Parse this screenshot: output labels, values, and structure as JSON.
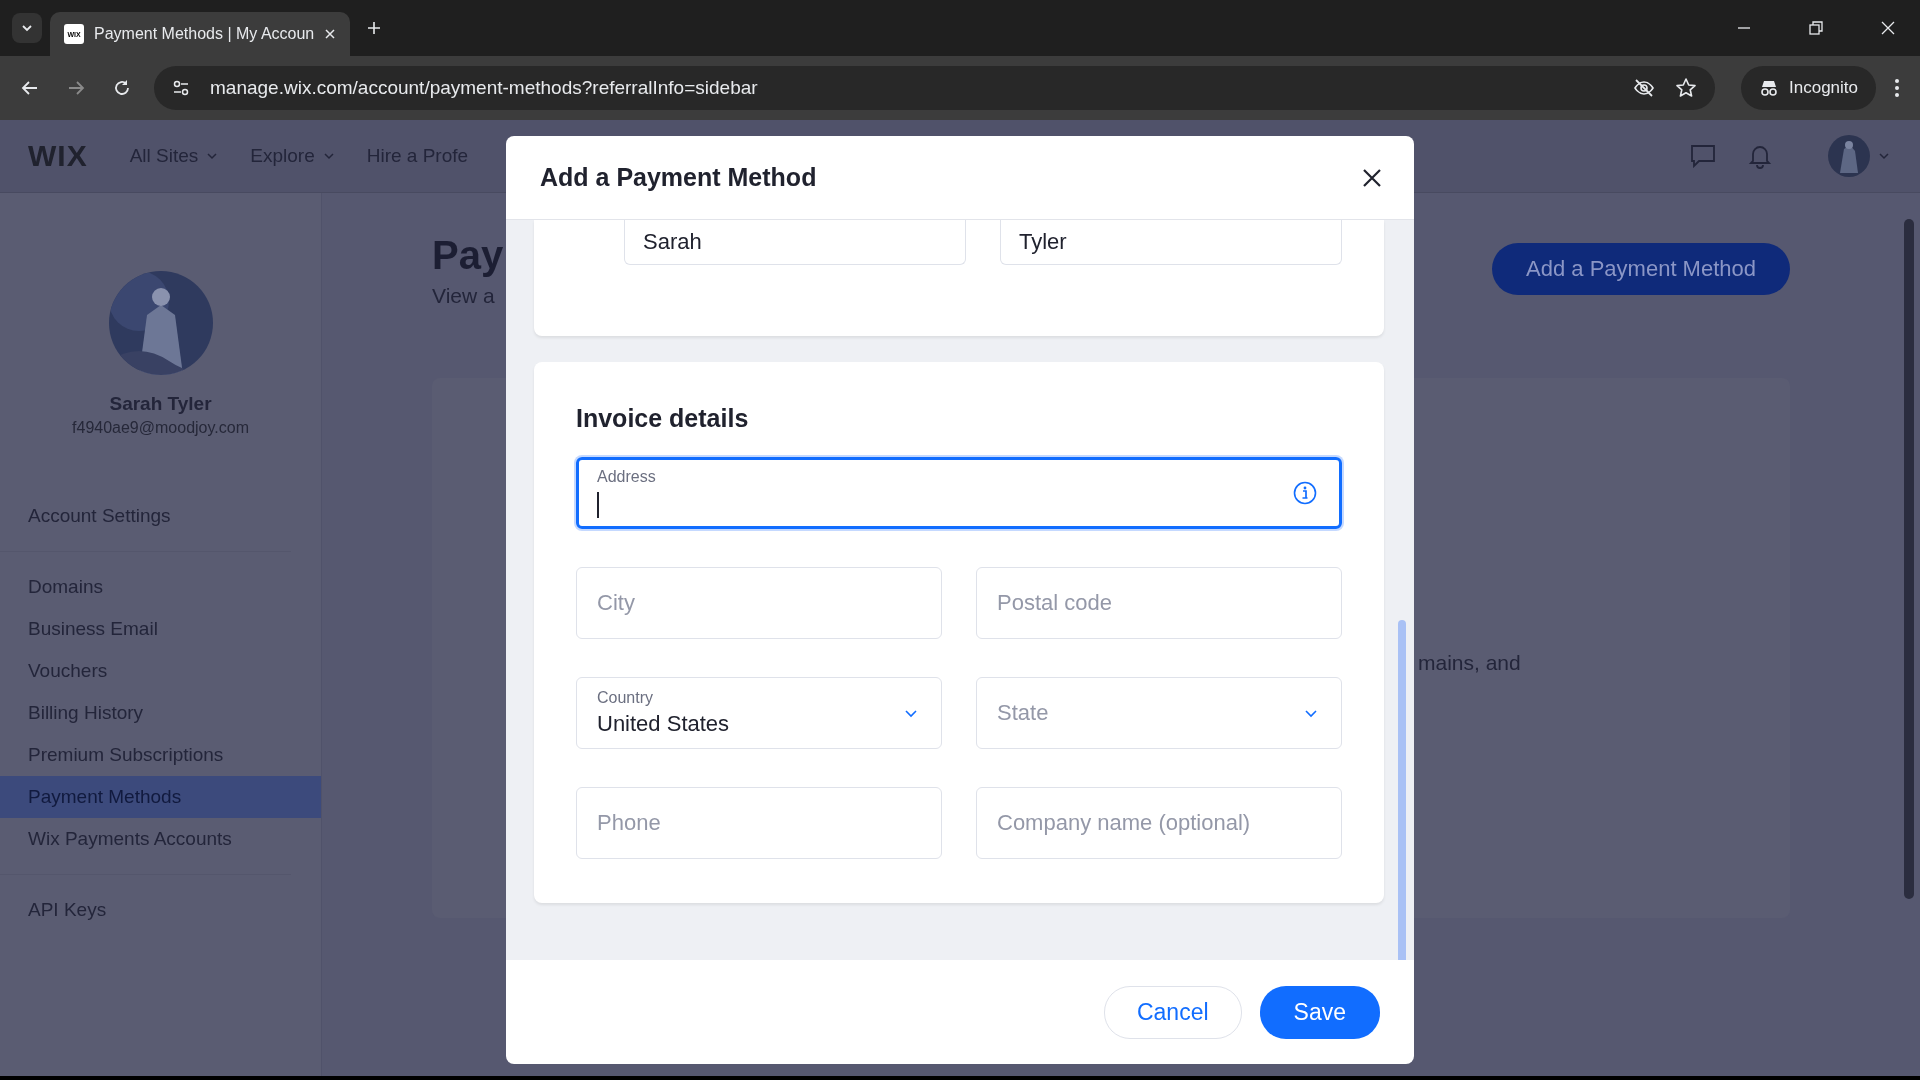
{
  "browser": {
    "tabs": [
      {
        "title": "Payment Methods | My Accoun",
        "favicon": "WIX",
        "selected": true
      }
    ],
    "url": "manage.wix.com/account/payment-methods?referralInfo=sidebar",
    "profile_label": "Incognito"
  },
  "header": {
    "logo": "WIX",
    "nav": [
      {
        "label": "All Sites",
        "dropdown": true
      },
      {
        "label": "Explore",
        "dropdown": true
      },
      {
        "label": "Hire a Profe",
        "dropdown": false
      }
    ]
  },
  "sidebar": {
    "user_name": "Sarah Tyler",
    "email": "f4940ae9@moodjoy.com",
    "groups": [
      [
        {
          "label": "Account Settings",
          "selected": false
        }
      ],
      [
        {
          "label": "Domains",
          "selected": false
        },
        {
          "label": "Business Email",
          "selected": false
        },
        {
          "label": "Vouchers",
          "selected": false
        },
        {
          "label": "Billing History",
          "selected": false
        },
        {
          "label": "Premium Subscriptions",
          "selected": false
        },
        {
          "label": "Payment Methods",
          "selected": true
        },
        {
          "label": "Wix Payments Accounts",
          "selected": false
        }
      ],
      [
        {
          "label": "API Keys",
          "selected": false
        }
      ]
    ]
  },
  "page": {
    "title": "Pay",
    "subtitle": "View a",
    "body_text": "mains, and",
    "primary_button": "Add a Payment Method"
  },
  "modal": {
    "title": "Add a Payment Method",
    "name_fields": [
      {
        "value": "Sarah"
      },
      {
        "value": "Tyler"
      }
    ],
    "section_title": "Invoice details",
    "fields": [
      {
        "kind": "text",
        "label": "Address",
        "focused": true,
        "info": true,
        "wide": true
      },
      {
        "kind": "text",
        "placeholder": "City",
        "focused": false,
        "info": false,
        "wide": false
      },
      {
        "kind": "text",
        "placeholder": "Postal code",
        "focused": false,
        "info": false,
        "wide": false
      },
      {
        "kind": "select",
        "label": "Country",
        "value": "United States",
        "focused": false,
        "info": false,
        "wide": false
      },
      {
        "kind": "select",
        "placeholder": "State",
        "focused": false,
        "info": false,
        "wide": false
      },
      {
        "kind": "text",
        "placeholder": "Phone",
        "focused": false,
        "info": false,
        "wide": false
      },
      {
        "kind": "text",
        "placeholder": "Company name (optional)",
        "focused": false,
        "info": false,
        "wide": false
      }
    ],
    "cancel_button": "Cancel",
    "save_button": "Save"
  }
}
